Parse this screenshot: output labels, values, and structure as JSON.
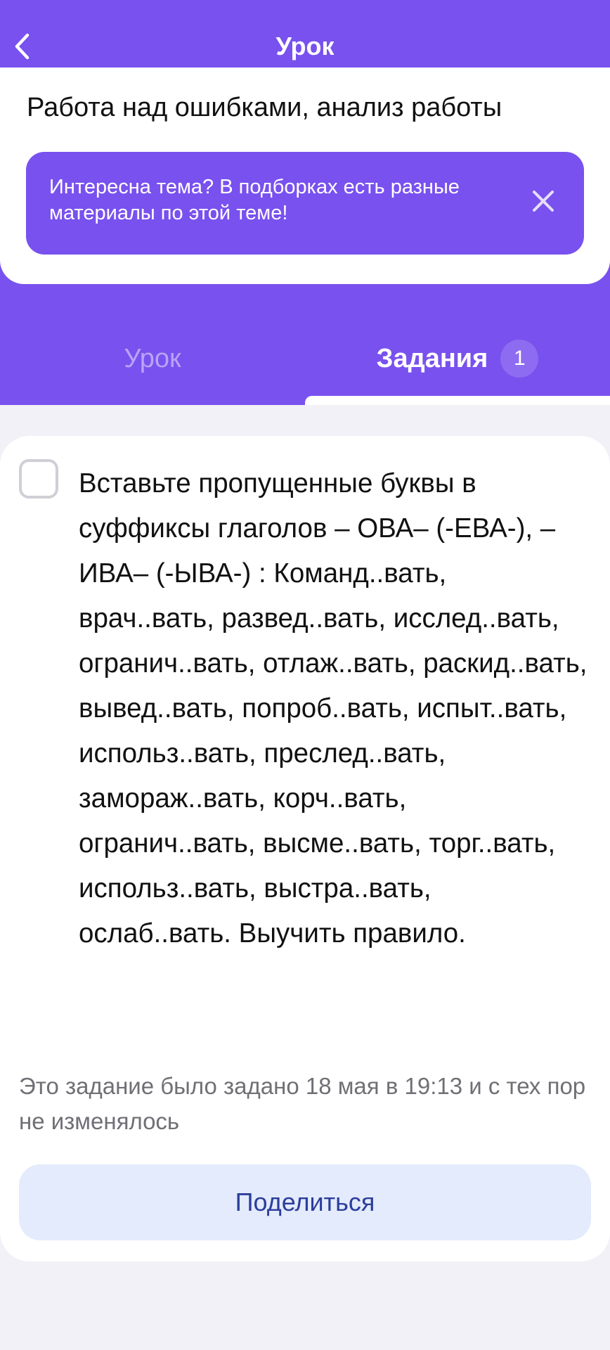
{
  "header": {
    "title": "Урок"
  },
  "lesson": {
    "title": "Работа над ошибками, анализ работы"
  },
  "promo": {
    "text": "Интересна тема? В подборках есть разные материалы по этой теме!"
  },
  "tabs": [
    {
      "label": "Урок",
      "active": false
    },
    {
      "label": "Задания",
      "active": true,
      "badge": "1"
    }
  ],
  "task": {
    "text": "Вставьте пропущенные буквы в суффиксы глаголов – ОВА– (-ЕВА-), – ИВА– (-ЫВА-) : Команд..вать, врач..вать, развед..вать, исслед..вать, огранич..вать, отлаж..вать, раскид..вать, вывед..вать, попроб..вать, испыт..вать, использ..вать, преслед..вать, замораж..вать, корч..вать, огранич..вать, высме..вать, торг..вать, использ..вать, выстра..вать, ослаб..вать. Выучить правило.",
    "checked": false,
    "meta": "Это задание было задано 18 мая в 19:13 и с тех пор не изменялось",
    "share_label": "Поделиться"
  },
  "colors": {
    "brand_purple": "#7951ee",
    "background": "#f1f1f7",
    "share_button_bg": "#e3ebfc",
    "share_button_text": "#2c3d9c"
  },
  "icons": {
    "back": "chevron-left-icon",
    "close": "close-icon",
    "checkbox": "checkbox-unchecked"
  }
}
